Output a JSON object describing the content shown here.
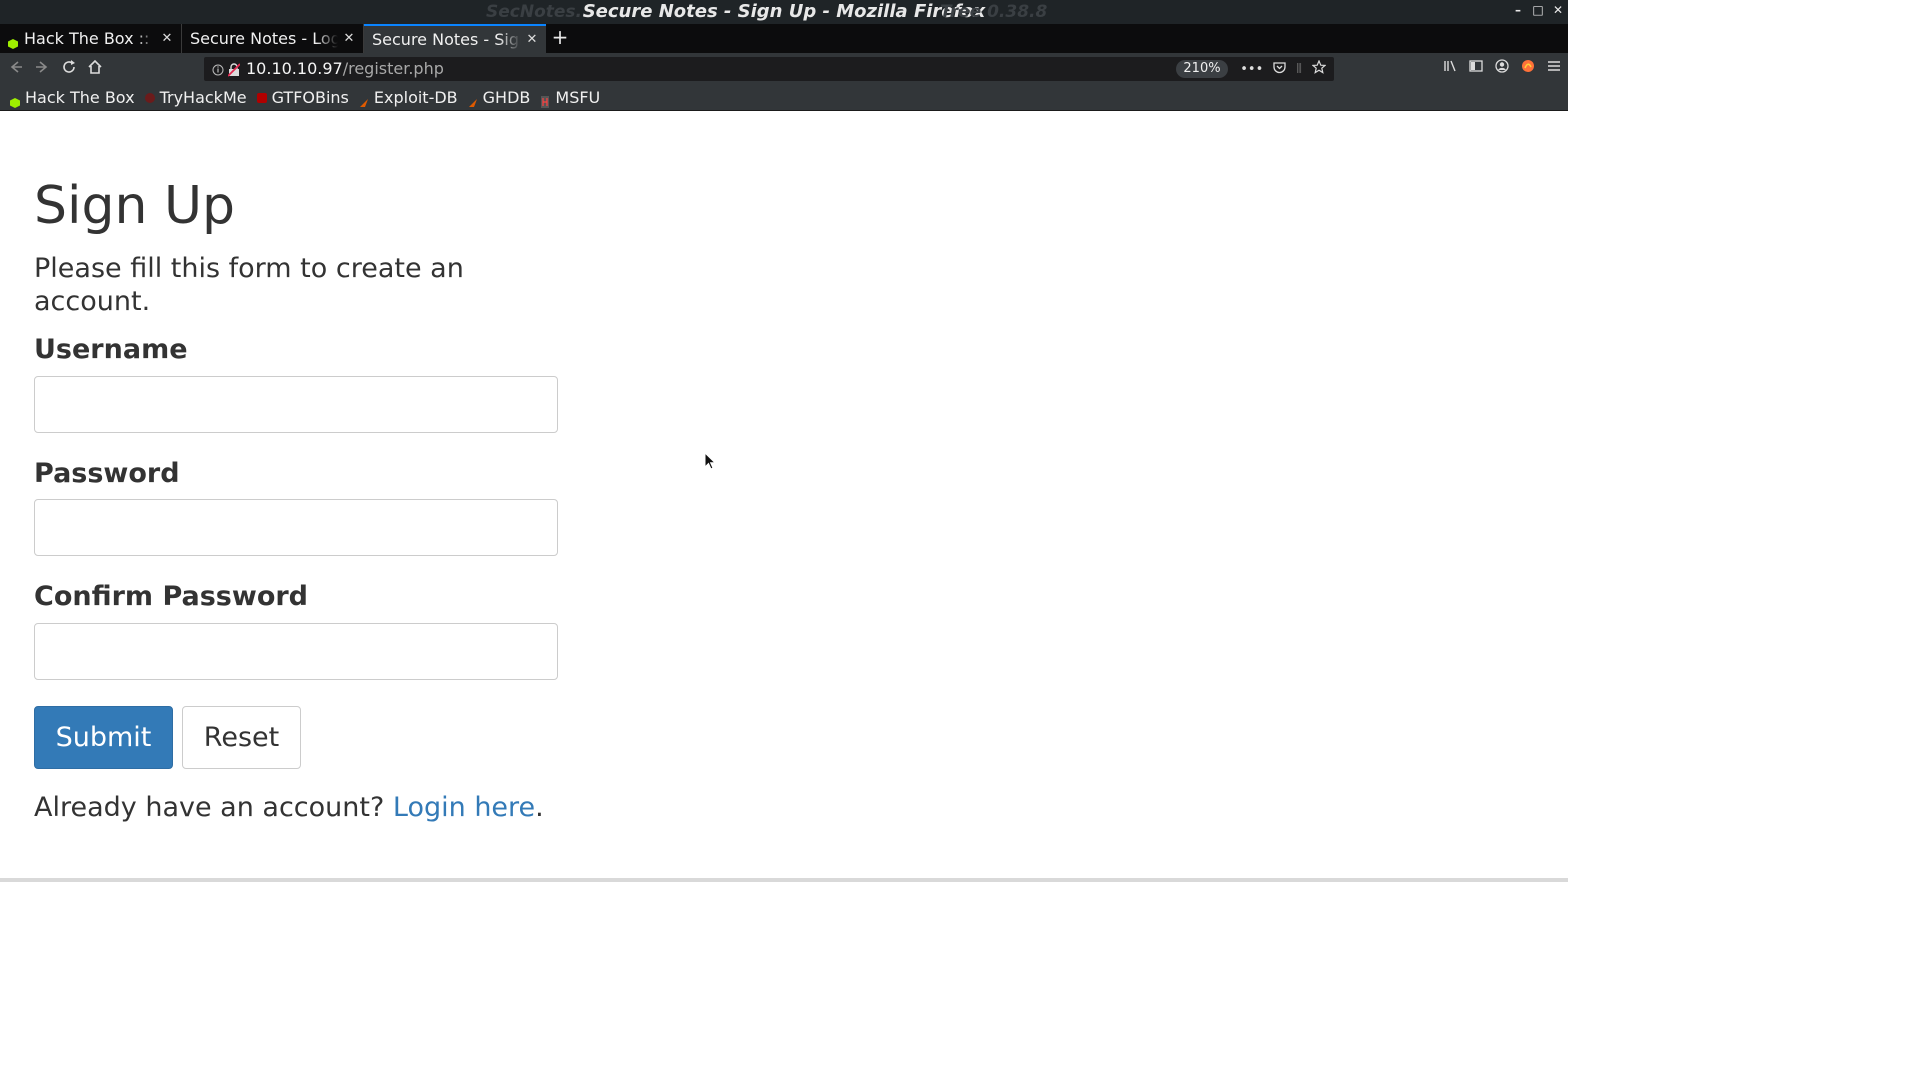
{
  "window": {
    "title": "Secure Notes - Sign Up - Mozilla Firefox",
    "ghost_left": "SecNotes.",
    "ghost_right": "Tree 0.38.8",
    "controls": [
      "–",
      "□",
      "✕"
    ]
  },
  "tabs": [
    {
      "label": "Hack The Box :: Machines",
      "favicon_color": "#9fef00",
      "active": false
    },
    {
      "label": "Secure Notes - Login",
      "favicon_color": "#cccccc",
      "active": false
    },
    {
      "label": "Secure Notes - Sign Up",
      "favicon_color": "#cccccc",
      "active": true
    }
  ],
  "tab_close_glyph": "✕",
  "new_tab_glyph": "+",
  "navigation": {
    "url_host": "10.10.10.97",
    "url_path": "/register.php",
    "zoom": "210%",
    "icons": [
      "back-icon",
      "forward-icon",
      "reload-icon",
      "home-icon"
    ],
    "page_actions": [
      "more-actions-icon",
      "pocket-icon",
      "reader-icon",
      "bookmark-star-icon"
    ],
    "toolbar_icons": [
      "library-icon",
      "sidebar-icon",
      "account-icon",
      "extension-icon",
      "menu-icon"
    ]
  },
  "bookmarks": [
    {
      "label": "Hack The Box",
      "color": "#9fef00"
    },
    {
      "label": "TryHackMe",
      "color": "#c11111"
    },
    {
      "label": "GTFOBins",
      "color": "#b00000"
    },
    {
      "label": "Exploit-DB",
      "color": "#e05a00"
    },
    {
      "label": "GHDB",
      "color": "#e05a00"
    },
    {
      "label": "MSFU",
      "color": "#888888"
    }
  ],
  "form": {
    "heading": "Sign Up",
    "intro": "Please fill this form to create an account.",
    "username_label": "Username",
    "username_value": "",
    "password_label": "Password",
    "password_value": "",
    "confirm_label": "Confirm Password",
    "confirm_value": "",
    "submit_label": "Submit",
    "reset_label": "Reset",
    "login_prompt": "Already have an account? ",
    "login_link": "Login here",
    "login_suffix": "."
  },
  "colors": {
    "primary": "#337ab7",
    "text": "#333333",
    "chrome_dark": "#323639",
    "tab_accent": "#0a84ff"
  }
}
